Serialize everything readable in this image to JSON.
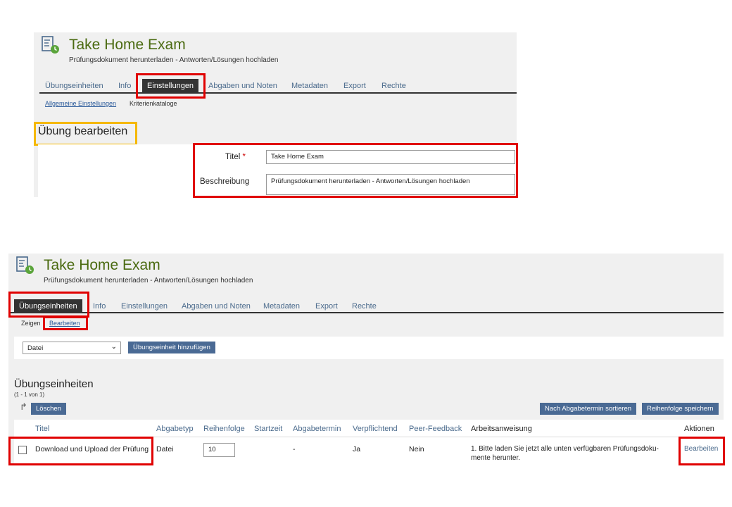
{
  "top": {
    "title": "Take Home Exam",
    "subtitle": "Prüfungsdokument herunterladen - Antworten/Lösungen hochladen",
    "tabs": [
      "Übungseinheiten",
      "Info",
      "Einstellungen",
      "Abgaben und Noten",
      "Metadaten",
      "Export",
      "Rechte"
    ],
    "active_tab": "Einstellungen",
    "subtabs": [
      "Allgemeine Einstellungen",
      "Kriterienkataloge"
    ],
    "heading": "Übung bearbeiten",
    "form": {
      "title_label": "Titel",
      "required_mark": "*",
      "title_value": "Take Home Exam",
      "desc_label": "Beschreibung",
      "desc_value": "Prüfungsdokument herunterladen - Antworten/Lösungen hochladen"
    }
  },
  "bottom": {
    "title": "Take Home Exam",
    "subtitle": "Prüfungsdokument herunterladen - Antworten/Lösungen hochladen",
    "tabs": [
      "Übungseinheiten",
      "Info",
      "Einstellungen",
      "Abgaben und Noten",
      "Metadaten",
      "Export",
      "Rechte"
    ],
    "active_tab": "Übungseinheiten",
    "subtabs": [
      "Zeigen",
      "Bearbeiten"
    ],
    "select_value": "Datei",
    "add_button": "Übungseinheit hinzufügen",
    "section_title": "Übungseinheiten",
    "count": "(1 - 1 von 1)",
    "delete_button": "Löschen",
    "sort_button": "Nach Abgabetermin sortieren",
    "save_order_button": "Reihenfolge speichern",
    "columns": [
      "Titel",
      "Abgabetyp",
      "Reihenfolge",
      "Startzeit",
      "Abgabetermin",
      "Verpflichtend",
      "Peer-Feedback",
      "Arbeitsanweisung",
      "Aktionen"
    ],
    "row": {
      "title": "Download und Upload der Prüfung",
      "type": "Datei",
      "order": "10",
      "start": "",
      "deadline": "-",
      "mandatory": "Ja",
      "peer": "Nein",
      "instruction_line1": "1. Bitte laden Sie jetzt alle unten verfügbaren Prüfungsdoku-",
      "instruction_line2": "mente herunter.",
      "action": "Bearbeiten"
    }
  },
  "colors": {
    "highlight_red": "#e00000",
    "highlight_yellow": "#f5b800",
    "title_green": "#4a6a10",
    "tab_dark": "#333333",
    "button_blue": "#4a6a94"
  }
}
